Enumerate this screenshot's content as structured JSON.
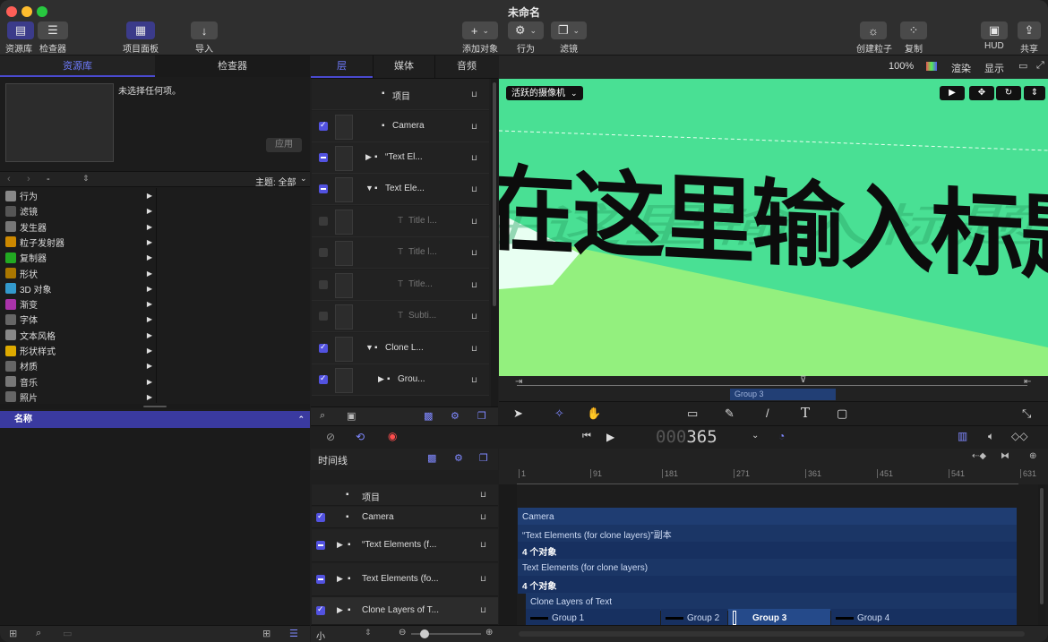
{
  "window": {
    "title": "未命名"
  },
  "toolbar": {
    "library_label": "资源库",
    "inspector_label": "检查器",
    "project_panel_label": "项目面板",
    "import_label": "导入",
    "add_object_label": "添加对象",
    "behaviors_label": "行为",
    "filters_label": "滤镜",
    "create_particles_label": "创建粒子",
    "replicate_label": "复制",
    "hud_label": "HUD",
    "share_label": "共享"
  },
  "left_panel": {
    "tabs": [
      "资源库",
      "检查器"
    ],
    "preview_text": "未选择任何项。",
    "apply_label": "应用",
    "nav_dash": "-",
    "theme_label": "主题: 全部",
    "categories": [
      "行为",
      "滤镜",
      "发生器",
      "粒子发射器",
      "复制器",
      "形状",
      "3D 对象",
      "渐变",
      "字体",
      "文本风格",
      "形状样式",
      "材质",
      "音乐",
      "照片"
    ],
    "name_header": "名称"
  },
  "layers_panel": {
    "tabs": [
      "层",
      "媒体",
      "音频"
    ],
    "rows": [
      {
        "name": "项目",
        "check": "none",
        "dim": false
      },
      {
        "name": "Camera",
        "check": "on",
        "dim": false
      },
      {
        "name": "“Text El...",
        "check": "mix",
        "dim": false
      },
      {
        "name": "Text Ele...",
        "check": "mix",
        "dim": false
      },
      {
        "name": "Title l...",
        "check": "off",
        "dim": true
      },
      {
        "name": "Title l...",
        "check": "off",
        "dim": true
      },
      {
        "name": "Title...",
        "check": "off",
        "dim": true
      },
      {
        "name": "Subti...",
        "check": "off",
        "dim": true
      },
      {
        "name": "Clone L...",
        "check": "on",
        "dim": false
      },
      {
        "name": "Grou...",
        "check": "on",
        "dim": false
      }
    ]
  },
  "canvas": {
    "zoom": "100%",
    "render_label": "渲染",
    "view_label": "显示",
    "camera_menu": "活跃的摄像机",
    "title_text": "在这里输入标题",
    "bg_color": "#49e094",
    "mini_group": "Group 3"
  },
  "transport": {
    "timecode_dim": "000",
    "timecode": "365"
  },
  "timeline": {
    "label": "时间线",
    "ruler": [
      "1",
      "91",
      "181",
      "271",
      "361",
      "451",
      "541",
      "631"
    ],
    "layers": [
      {
        "name": "项目",
        "check": "none"
      },
      {
        "name": "Camera",
        "check": "on"
      },
      {
        "name": "“Text Elements (f...",
        "check": "mix"
      },
      {
        "name": "Text Elements (fo...",
        "check": "mix"
      },
      {
        "name": "Clone Layers of T...",
        "check": "on"
      }
    ],
    "bars": {
      "camera": "Camera",
      "text_copy": "“Text Elements (for clone layers)”副本",
      "objects1": "4 个对象",
      "text_elements": "Text Elements (for clone layers)",
      "objects2": "4 个对象",
      "clone_layers": "Clone Layers of Text",
      "groups": [
        "Group 1",
        "Group 2",
        "Group 3",
        "Group 4"
      ]
    },
    "size_label": "小"
  }
}
